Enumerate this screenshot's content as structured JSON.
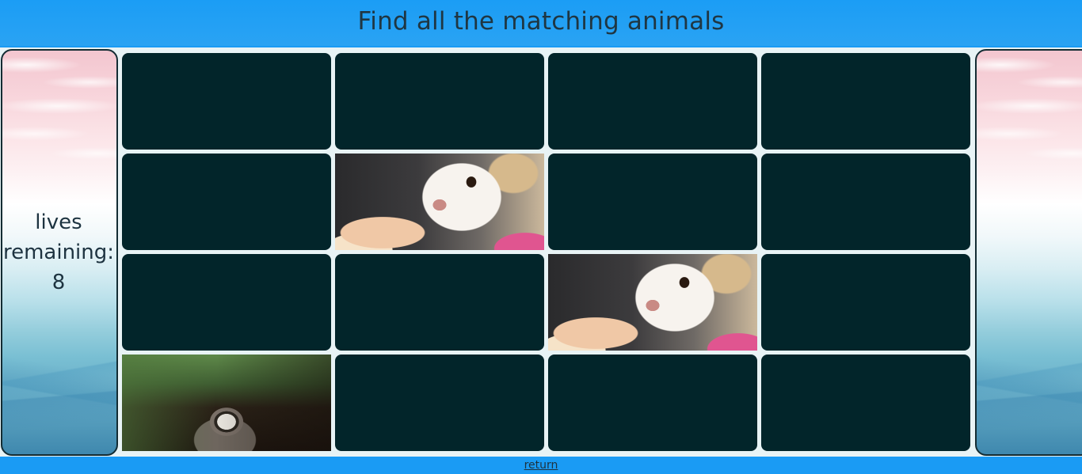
{
  "header": {
    "title": "Find all the matching animals"
  },
  "lives": {
    "line1": "lives",
    "line2": "remaining:",
    "count": "8"
  },
  "board": {
    "rows": 4,
    "columns": 4,
    "cards": [
      {
        "state": "hidden"
      },
      {
        "state": "hidden"
      },
      {
        "state": "hidden"
      },
      {
        "state": "hidden"
      },
      {
        "state": "hidden"
      },
      {
        "state": "revealed",
        "animal": "chihuahua"
      },
      {
        "state": "hidden"
      },
      {
        "state": "hidden"
      },
      {
        "state": "hidden"
      },
      {
        "state": "hidden"
      },
      {
        "state": "revealed",
        "animal": "chihuahua"
      },
      {
        "state": "hidden"
      },
      {
        "state": "revealed",
        "animal": "raccoon"
      },
      {
        "state": "hidden"
      },
      {
        "state": "hidden"
      },
      {
        "state": "hidden"
      }
    ]
  },
  "footer": {
    "return_label": "return"
  },
  "colors": {
    "header_bg": "#1b9df5",
    "card_back": "#02252a",
    "text": "#1d3340"
  }
}
